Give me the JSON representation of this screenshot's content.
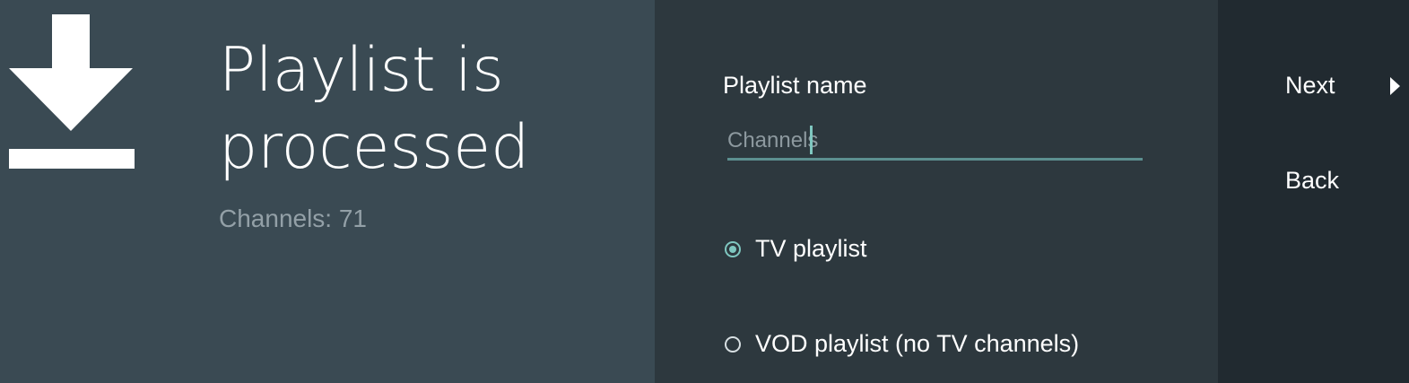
{
  "header": {
    "icon": "download-icon",
    "title": "Playlist is processed",
    "subtitle": "Channels: 71"
  },
  "form": {
    "name_label": "Playlist name",
    "name_value": "Channels",
    "options": [
      {
        "label": "TV playlist",
        "selected": true
      },
      {
        "label": "VOD playlist (no TV channels)",
        "selected": false
      }
    ]
  },
  "actions": {
    "next_label": "Next",
    "next_icon": "triangle-right-icon",
    "back_label": "Back"
  },
  "colors": {
    "left_panel": "#3a4a53",
    "middle_panel": "#2d383e",
    "right_panel": "#212a30",
    "accent": "#7fc7c0"
  }
}
